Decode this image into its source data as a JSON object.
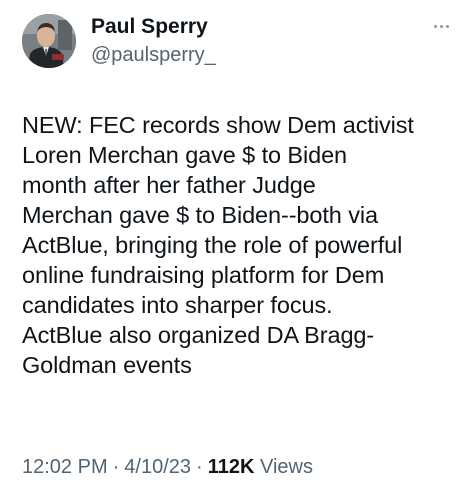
{
  "tweet": {
    "author": {
      "display_name": "Paul Sperry",
      "handle": "@paulsperry_",
      "avatar_icon": "user-avatar"
    },
    "more_icon": "more-options-icon",
    "text": "NEW: FEC records show Dem activist\nLoren Merchan gave $ to Biden\nmonth after her father Judge\nMerchan gave $ to Biden--both via\nActBlue, bringing the role of powerful\nonline fundraising platform for Dem\ncandidates into sharper focus.\nActBlue also organized DA Bragg-\nGoldman events",
    "meta": {
      "time": "12:02 PM",
      "separator": "·",
      "date": "4/10/23",
      "views_count": "112K",
      "views_label": "Views"
    }
  },
  "colors": {
    "text_primary": "#0f1419",
    "text_secondary": "#536471",
    "background": "#ffffff"
  }
}
